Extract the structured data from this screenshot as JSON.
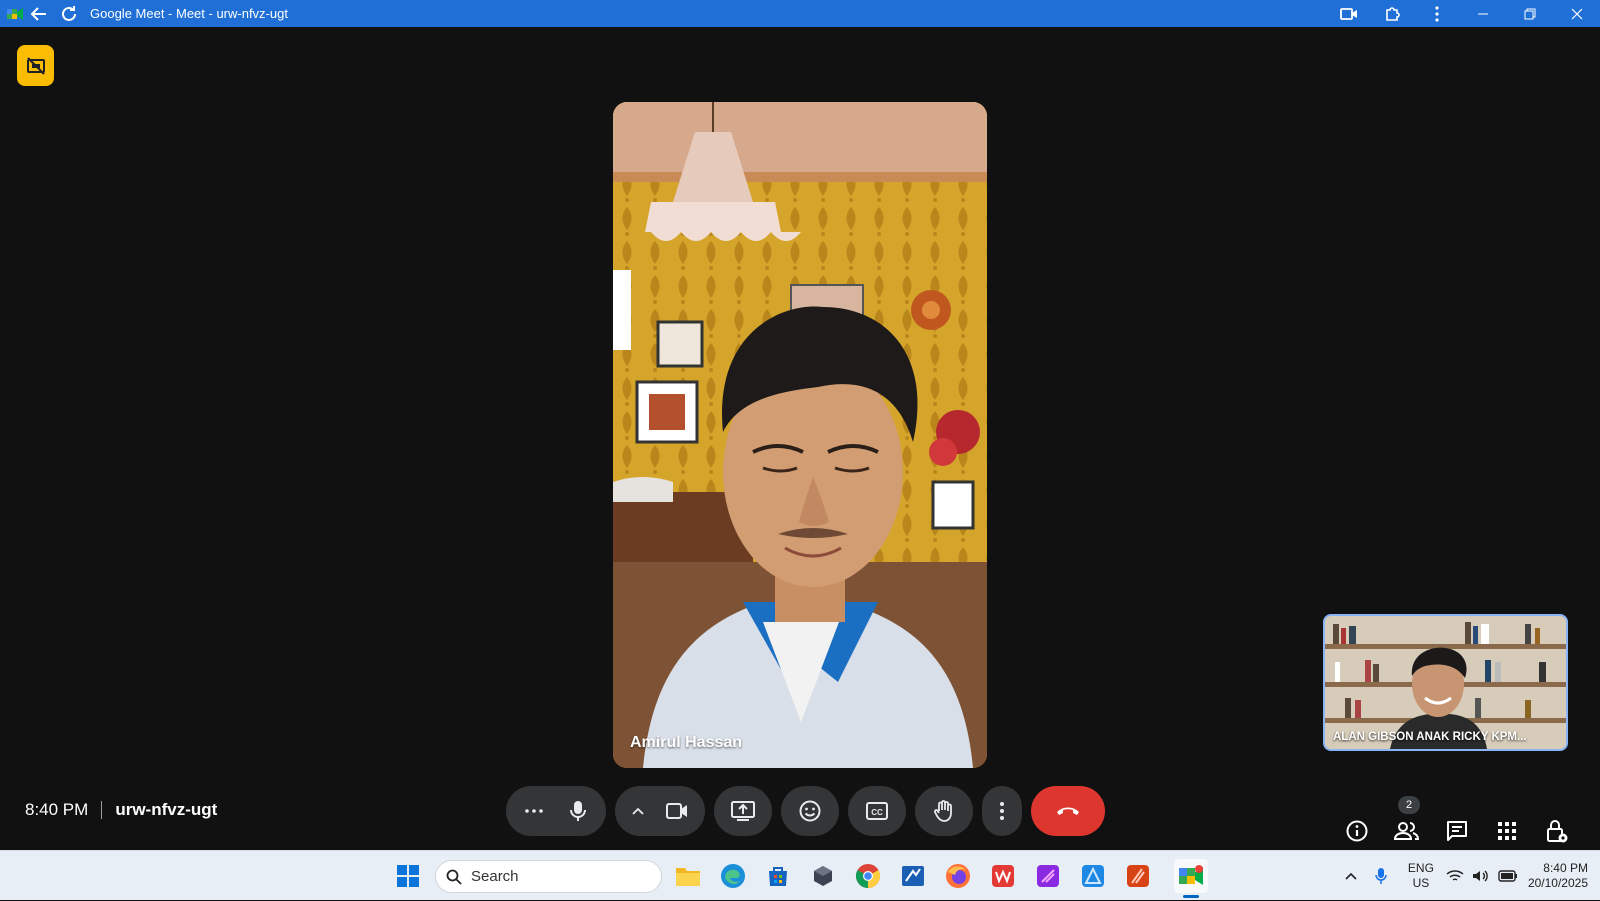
{
  "window": {
    "title": "Google Meet - Meet - urw-nfvz-ugt"
  },
  "main_participant": {
    "name": "Amirul Hassan"
  },
  "self_view": {
    "name": "ALAN GIBSON ANAK RICKY KPM..."
  },
  "meeting": {
    "time": "8:40 PM",
    "code": "urw-nfvz-ugt",
    "participant_count": "2"
  },
  "controls": {
    "icons": [
      "more-options-icon",
      "microphone-icon",
      "caret-up-icon",
      "camera-icon",
      "present-screen-icon",
      "emoji-icon",
      "captions-icon",
      "raise-hand-icon",
      "more-vert-icon",
      "hang-up-icon"
    ]
  },
  "right_tools": {
    "icons": [
      "info-icon",
      "people-icon",
      "chat-icon",
      "activities-icon",
      "host-controls-icon"
    ]
  },
  "taskbar": {
    "search_label": "Search",
    "lang_primary": "ENG",
    "lang_secondary": "US",
    "clock_time": "8:40 PM",
    "clock_date": "20/10/2025"
  },
  "colors": {
    "titlebar": "#1f6fd6",
    "stage": "#111111",
    "control_bg": "#333537",
    "hangup": "#dc362e",
    "recording": "#fbbc04"
  }
}
